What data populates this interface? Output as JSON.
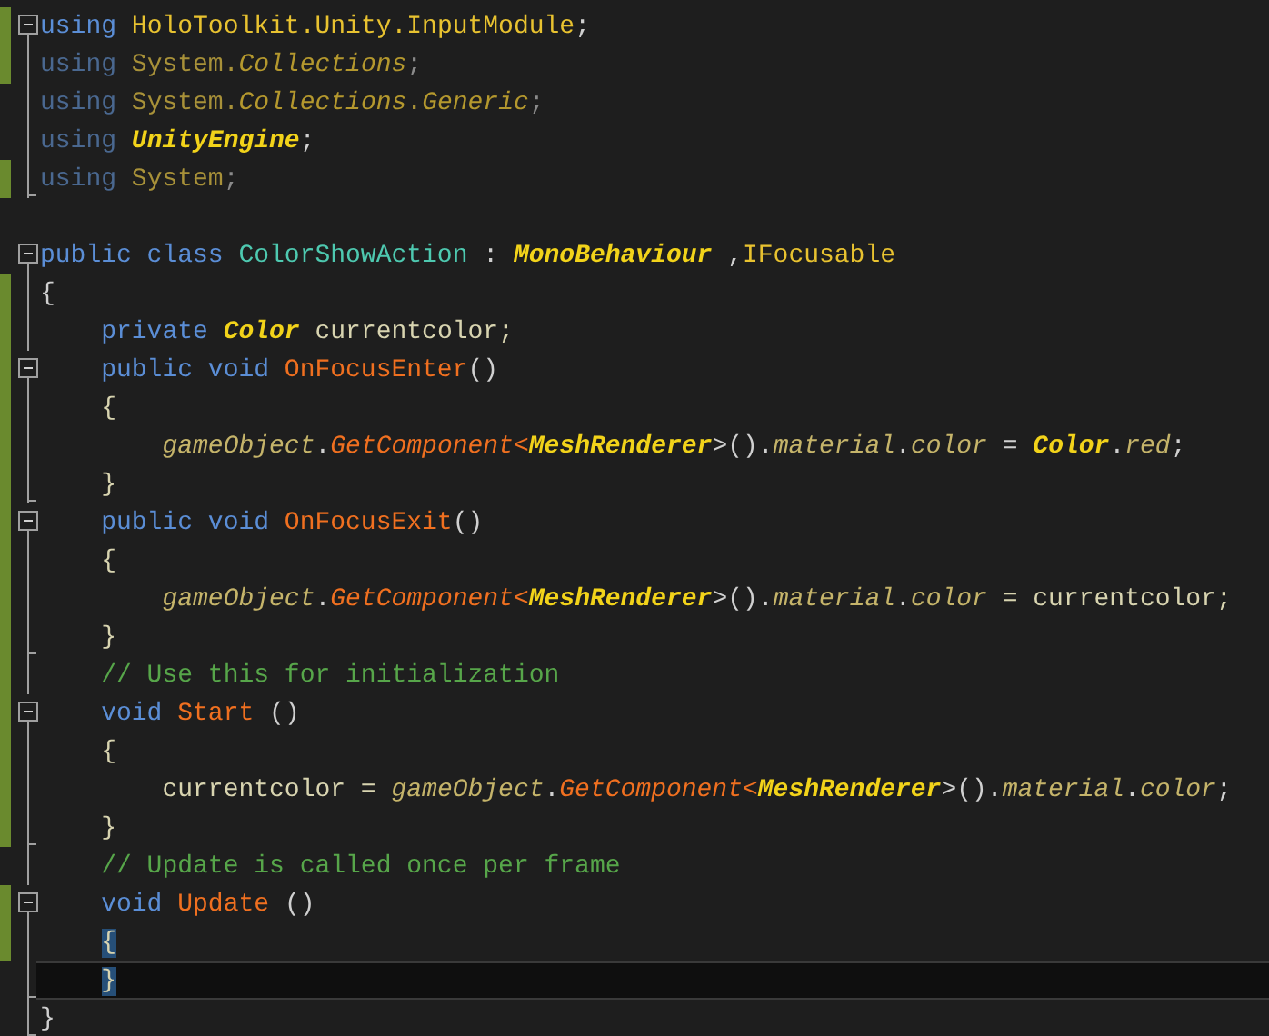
{
  "editor": {
    "lines": [
      {
        "kind": "fold",
        "modified": true,
        "current": false,
        "tokens": [
          {
            "text": "using",
            "kind": "kw"
          },
          {
            "text": " HoloToolkit.Unity.InputModule",
            "kind": "ns"
          },
          {
            "text": ";",
            "kind": "punct"
          }
        ]
      },
      {
        "kind": "line",
        "modified": true,
        "current": false,
        "tokens": [
          {
            "text": "using",
            "kind": "kw-dim"
          },
          {
            "text": " System.",
            "kind": "ns-dim"
          },
          {
            "text": "Collections",
            "kind": "ns-italic-dim"
          },
          {
            "text": ";",
            "kind": "punct-dim"
          }
        ]
      },
      {
        "kind": "line",
        "modified": false,
        "current": false,
        "tokens": [
          {
            "text": "using",
            "kind": "kw-dim"
          },
          {
            "text": " System.",
            "kind": "ns-dim"
          },
          {
            "text": "Collections",
            "kind": "ns-italic-dim"
          },
          {
            "text": ".",
            "kind": "ns-dim"
          },
          {
            "text": "Generic",
            "kind": "ns-italic-dim"
          },
          {
            "text": ";",
            "kind": "punct-dim"
          }
        ]
      },
      {
        "kind": "line",
        "modified": false,
        "current": false,
        "tokens": [
          {
            "text": "using ",
            "kind": "kw-dim"
          },
          {
            "text": "UnityEngine",
            "kind": "type-italic"
          },
          {
            "text": ";",
            "kind": "punct"
          }
        ]
      },
      {
        "kind": "end",
        "modified": true,
        "current": false,
        "tokens": [
          {
            "text": "using",
            "kind": "kw-dim"
          },
          {
            "text": " System",
            "kind": "ns-dim"
          },
          {
            "text": ";",
            "kind": "punct-dim"
          }
        ]
      },
      {
        "kind": "none",
        "modified": false,
        "current": false
      },
      {
        "kind": "fold",
        "modified": false,
        "current": false,
        "tokens": [
          {
            "text": "public class ",
            "kind": "kw"
          },
          {
            "text": "ColorShowAction",
            "kind": "classname"
          },
          {
            "text": " : ",
            "kind": "punct"
          },
          {
            "text": "MonoBehaviour",
            "kind": "type-italic"
          },
          {
            "text": " ,",
            "kind": "punct"
          },
          {
            "text": "IFocusable",
            "kind": "ns"
          }
        ]
      },
      {
        "kind": "line",
        "modified": true,
        "current": false,
        "tokens": [
          {
            "text": "{",
            "kind": "punct"
          }
        ]
      },
      {
        "kind": "line",
        "modified": true,
        "current": false,
        "tokens": [
          {
            "text": "    private ",
            "kind": "kw"
          },
          {
            "text": "Color",
            "kind": "type-italic"
          },
          {
            "text": " currentcolor;",
            "kind": "plain"
          }
        ]
      },
      {
        "kind": "fold",
        "modified": true,
        "current": false,
        "tokens": [
          {
            "text": "    public void ",
            "kind": "kw"
          },
          {
            "text": "OnFocusEnter",
            "kind": "method"
          },
          {
            "text": "()",
            "kind": "punct"
          }
        ]
      },
      {
        "kind": "line",
        "modified": true,
        "current": false,
        "tokens": [
          {
            "text": "    {",
            "kind": "plain"
          }
        ]
      },
      {
        "kind": "line",
        "modified": true,
        "current": false,
        "tokens": [
          {
            "text": "        gameObject",
            "kind": "member"
          },
          {
            "text": ".",
            "kind": "punct"
          },
          {
            "text": "GetComponent",
            "kind": "method-italic"
          },
          {
            "text": "<",
            "kind": "method"
          },
          {
            "text": "MeshRenderer",
            "kind": "type-italic"
          },
          {
            "text": ">().",
            "kind": "punct"
          },
          {
            "text": "material",
            "kind": "member"
          },
          {
            "text": ".",
            "kind": "punct"
          },
          {
            "text": "color",
            "kind": "member"
          },
          {
            "text": " = ",
            "kind": "punct"
          },
          {
            "text": "Color",
            "kind": "type-italic"
          },
          {
            "text": ".",
            "kind": "punct"
          },
          {
            "text": "red",
            "kind": "member"
          },
          {
            "text": ";",
            "kind": "punct"
          }
        ]
      },
      {
        "kind": "end",
        "modified": true,
        "current": false,
        "tokens": [
          {
            "text": "    }",
            "kind": "plain"
          }
        ]
      },
      {
        "kind": "fold",
        "modified": true,
        "current": false,
        "tokens": [
          {
            "text": "    public void ",
            "kind": "kw"
          },
          {
            "text": "OnFocusExit",
            "kind": "method"
          },
          {
            "text": "()",
            "kind": "punct"
          }
        ]
      },
      {
        "kind": "line",
        "modified": true,
        "current": false,
        "tokens": [
          {
            "text": "    {",
            "kind": "plain"
          }
        ]
      },
      {
        "kind": "line",
        "modified": true,
        "current": false,
        "tokens": [
          {
            "text": "        gameObject",
            "kind": "member"
          },
          {
            "text": ".",
            "kind": "punct"
          },
          {
            "text": "GetComponent",
            "kind": "method-italic"
          },
          {
            "text": "<",
            "kind": "method"
          },
          {
            "text": "MeshRenderer",
            "kind": "type-italic"
          },
          {
            "text": ">().",
            "kind": "punct"
          },
          {
            "text": "material",
            "kind": "member"
          },
          {
            "text": ".",
            "kind": "punct"
          },
          {
            "text": "color",
            "kind": "member"
          },
          {
            "text": " = currentcolor;",
            "kind": "plain"
          }
        ]
      },
      {
        "kind": "end",
        "modified": true,
        "current": false,
        "tokens": [
          {
            "text": "    }",
            "kind": "plain"
          }
        ]
      },
      {
        "kind": "line",
        "modified": true,
        "current": false,
        "tokens": [
          {
            "text": "    // Use this for initialization",
            "kind": "comment"
          }
        ]
      },
      {
        "kind": "fold",
        "modified": true,
        "current": false,
        "tokens": [
          {
            "text": "    void ",
            "kind": "kw"
          },
          {
            "text": "Start",
            "kind": "method"
          },
          {
            "text": " ()",
            "kind": "punct"
          }
        ]
      },
      {
        "kind": "line",
        "modified": true,
        "current": false,
        "tokens": [
          {
            "text": "    {",
            "kind": "plain"
          }
        ]
      },
      {
        "kind": "line",
        "modified": true,
        "current": false,
        "tokens": [
          {
            "text": "        currentcolor = ",
            "kind": "plain"
          },
          {
            "text": "gameObject",
            "kind": "member"
          },
          {
            "text": ".",
            "kind": "punct"
          },
          {
            "text": "GetComponent",
            "kind": "method-italic"
          },
          {
            "text": "<",
            "kind": "method"
          },
          {
            "text": "MeshRenderer",
            "kind": "type-italic"
          },
          {
            "text": ">().",
            "kind": "punct"
          },
          {
            "text": "material",
            "kind": "member"
          },
          {
            "text": ".",
            "kind": "punct"
          },
          {
            "text": "color",
            "kind": "member"
          },
          {
            "text": ";",
            "kind": "punct"
          }
        ]
      },
      {
        "kind": "end",
        "modified": true,
        "current": false,
        "tokens": [
          {
            "text": "    }",
            "kind": "plain"
          }
        ]
      },
      {
        "kind": "line",
        "modified": false,
        "current": false,
        "tokens": [
          {
            "text": "    // Update is called once per frame",
            "kind": "comment"
          }
        ]
      },
      {
        "kind": "fold",
        "modified": true,
        "current": false,
        "tokens": [
          {
            "text": "    void ",
            "kind": "kw"
          },
          {
            "text": "Update",
            "kind": "method"
          },
          {
            "text": " ()",
            "kind": "punct"
          }
        ]
      },
      {
        "kind": "line",
        "modified": true,
        "current": false,
        "tokens": [
          {
            "text": "    {",
            "kind": "brace"
          }
        ]
      },
      {
        "kind": "end",
        "modified": false,
        "current": true,
        "tokens": [
          {
            "text": "    }",
            "kind": "brace"
          }
        ]
      },
      {
        "kind": "end",
        "modified": false,
        "current": false,
        "tokens": [
          {
            "text": "}",
            "kind": "punct"
          }
        ]
      }
    ]
  }
}
